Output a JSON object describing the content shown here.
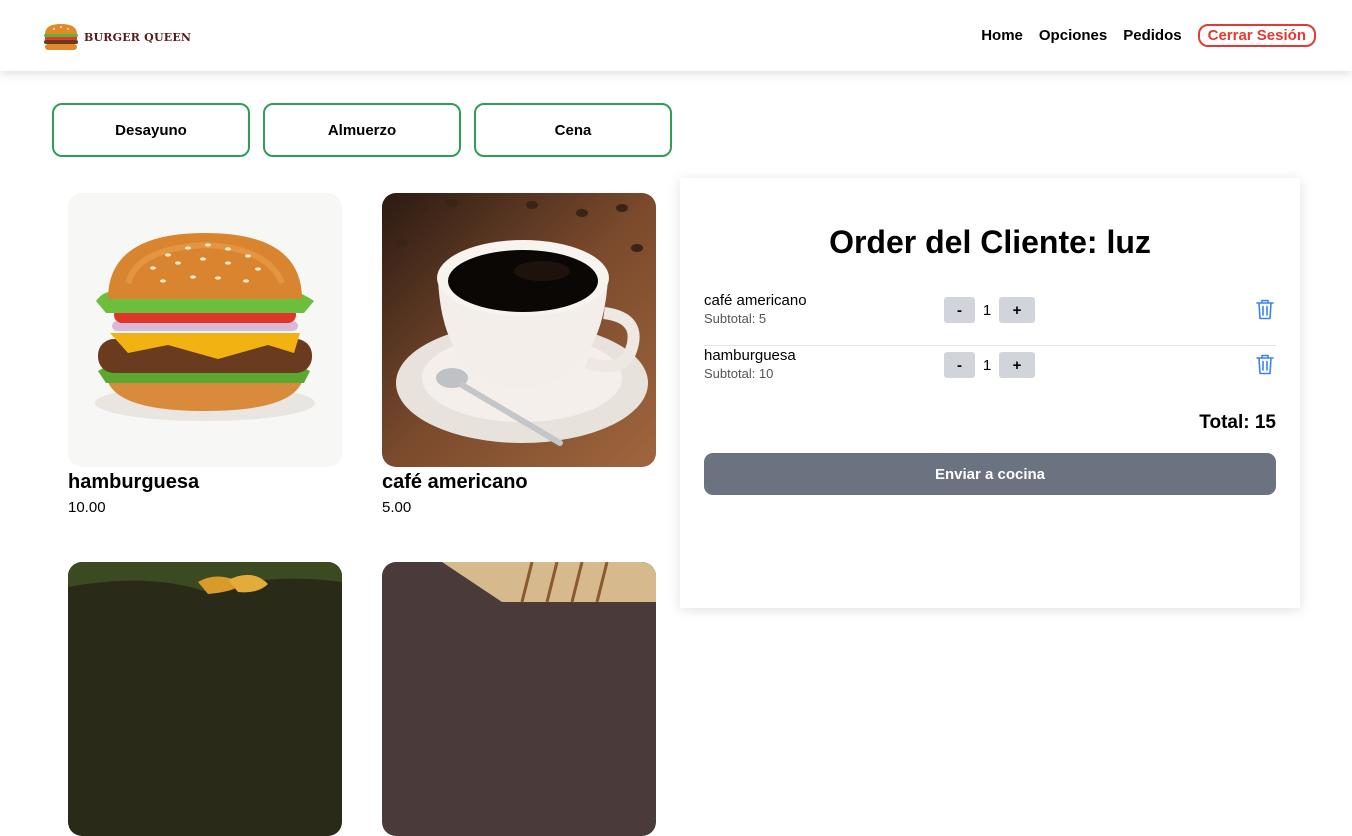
{
  "header": {
    "logo_text": "BURGER QUEEN",
    "logo_icon": "burger-icon",
    "nav": {
      "home": "Home",
      "options": "Opciones",
      "orders": "Pedidos",
      "logout": "Cerrar Sesión"
    }
  },
  "categories": [
    "Desayuno",
    "Almuerzo",
    "Cena"
  ],
  "colors": {
    "accent_green": "#2e9e57",
    "logout_red": "#e53935",
    "qty_button": "#d1d5db",
    "send_button": "#6b7280",
    "trash_icon": "#3b82f6"
  },
  "products": [
    {
      "name": "hamburguesa",
      "price": "10.00",
      "image": "burger-photo"
    },
    {
      "name": "café americano",
      "price": "5.00",
      "image": "coffee-photo"
    },
    {
      "image": "fried-food-photo"
    },
    {
      "image": "sandwich-photo"
    }
  ],
  "order": {
    "title": "Order del Cliente: luz",
    "items": [
      {
        "name": "café americano",
        "subtotal": "Subtotal: 5",
        "qty": "1",
        "minus": "-",
        "plus": "+"
      },
      {
        "name": "hamburguesa",
        "subtotal": "Subtotal: 10",
        "qty": "1",
        "minus": "-",
        "plus": "+"
      }
    ],
    "total": "Total: 15",
    "send_label": "Enviar a cocina"
  }
}
